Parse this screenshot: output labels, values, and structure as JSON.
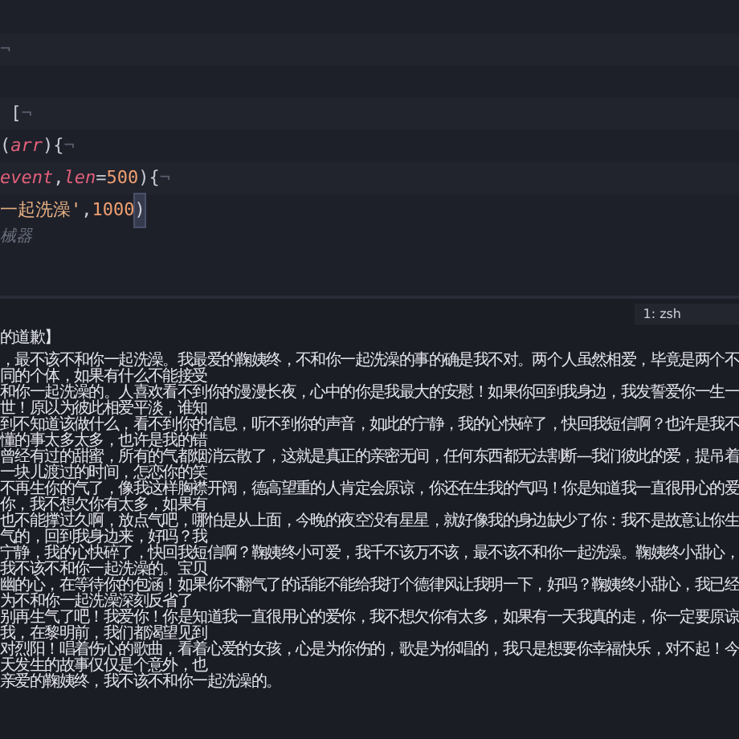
{
  "editor": {
    "lines": [
      {
        "kind": "blank"
      },
      {
        "kind": "code",
        "segments": [
          {
            "text": "¬",
            "kind": "eol"
          }
        ]
      },
      {
        "kind": "blank"
      },
      {
        "kind": "code",
        "segments": [
          {
            "text": " [",
            "kind": "punct"
          },
          {
            "text": "¬",
            "kind": "eol"
          }
        ]
      },
      {
        "kind": "code",
        "segments": [
          {
            "text": "(",
            "kind": "punct"
          },
          {
            "text": "arr",
            "kind": "param"
          },
          {
            "text": "){",
            "kind": "punct"
          },
          {
            "text": "¬",
            "kind": "eol"
          }
        ]
      },
      {
        "kind": "code",
        "segments": [
          {
            "text": "event",
            "kind": "param"
          },
          {
            "text": ",",
            "kind": "punct"
          },
          {
            "text": "len",
            "kind": "param"
          },
          {
            "text": "=",
            "kind": "punct"
          },
          {
            "text": "500",
            "kind": "number"
          },
          {
            "text": "){",
            "kind": "punct"
          },
          {
            "text": "¬",
            "kind": "eol"
          }
        ]
      },
      {
        "kind": "code",
        "segments": [
          {
            "text": "一起洗澡'",
            "kind": "string"
          },
          {
            "text": ",",
            "kind": "punct"
          },
          {
            "text": "1000",
            "kind": "number"
          },
          {
            "text": ")",
            "kind": "match"
          }
        ]
      },
      {
        "kind": "hint",
        "segments": [
          {
            "text": "械器",
            "kind": "hint"
          }
        ]
      }
    ]
  },
  "terminal": {
    "tab": "1: zsh",
    "heading": "的道歉】",
    "lines": [
      "，最不该不和你一起洗澡。我最爱的鞠姨终，不和你一起洗澡的事的确是我不对。两个人虽然相爱，毕竟是两个不同的个体，如果有什么不能接受",
      "和你一起洗澡的。人喜欢看不到你的漫漫长夜，心中的你是我最大的安慰！如果你回到我身边，我发誓爱你一生一世！原以为彼此相爱平淡，谁知",
      "到不知道该做什么，看不到你的信息，听不到你的声音，如此的宁静，我的心快碎了，快回我短信啊？也许是我不懂的事太多太多，也许是我的错",
      "曾经有过的甜蜜，所有的气都烟消云散了，这就是真正的亲密无间，任何东西都无法割断—我们彼此的爱，提吊着一块儿渡过的时间，怎恋你的笑",
      "不再生你的气了，像我这样胸襟开阔，德高望重的人肯定会原谅，你还在生我的气吗！你是知道我一直很用心的爱你，我不想欠你有太多，如果有",
      "也不能撑过久啊，放点气吧，哪怕是从上面，今晚的夜空没有星星，就好像我的身边缺少了你：我不是故意让你生气的，回到我身边来，好吗？我",
      "宁静，我的心快碎了，快回我短信啊？鞠姨终小可爱，我千不该万不该，最不该不和你一起洗澡。鞠姨终小甜心，我不该不和你一起洗澡的。宝贝",
      "幽的心，在等待你的包涵！如果你不翻气了的话能不能给我打个德律风让我明一下，好吗？鞠姨终小甜心，我已经为不和你一起洗澡深刻反省了",
      "别再生气了吧！我爱你！你是知道我一直很用心的爱你，我不想欠你有太多，如果有一天我真的走，你一定要原谅我，在黎明前，我们都渴望见到",
      "对烈阳！唱着伤心的歌曲，看着心爱的女孩，心是为你伤的，歌是为你唱的，我只是想要你幸福快乐，对不起！今天发生的故事仅仅是个意外，也",
      "亲爱的鞠姨终，我不该不和你一起洗澡的。"
    ]
  }
}
